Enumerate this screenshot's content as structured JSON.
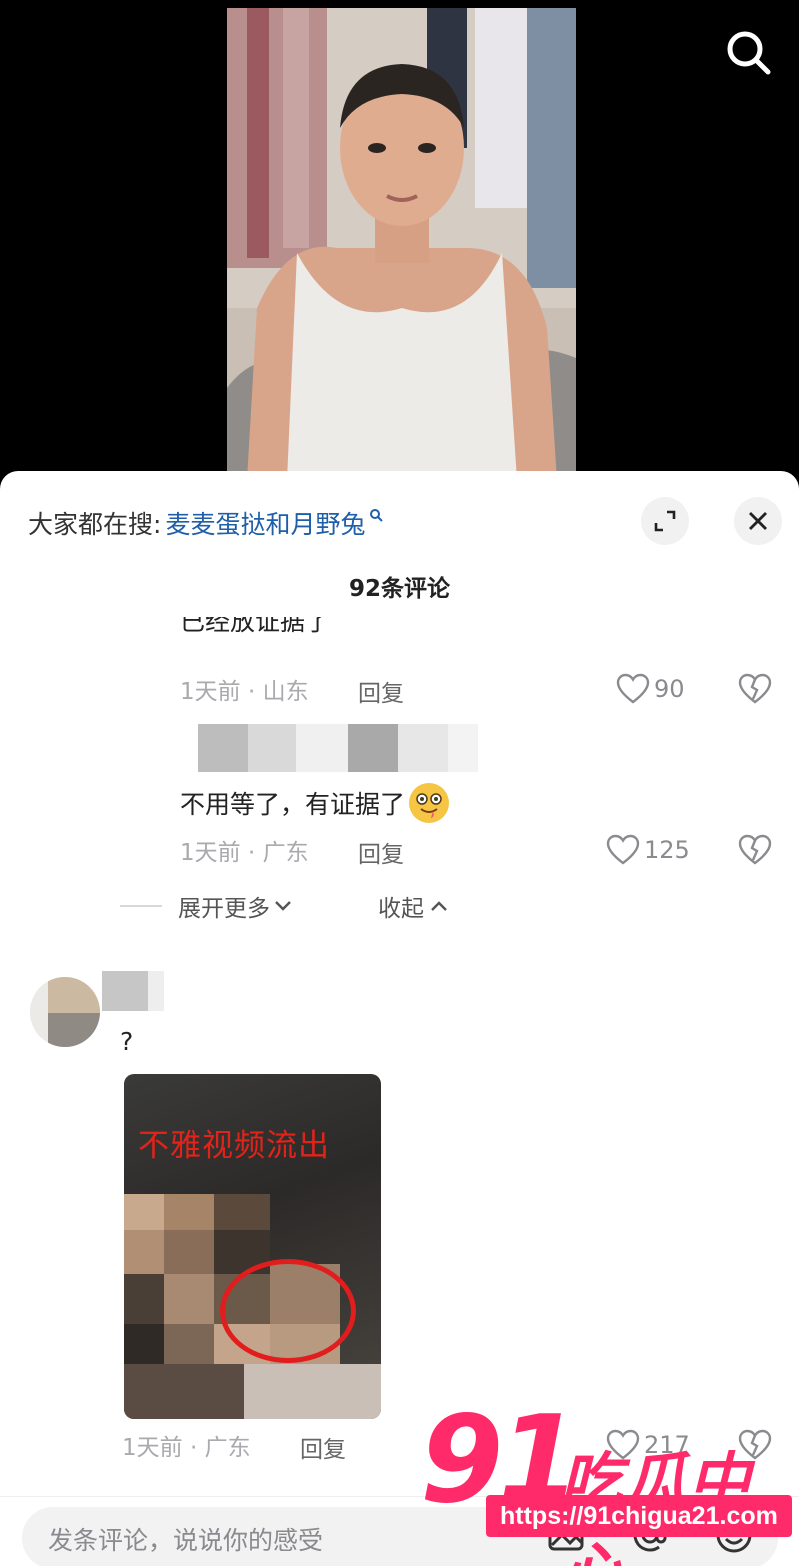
{
  "video": {
    "search_icon": "search-icon"
  },
  "sheet": {
    "trending_prefix": "大家都在搜:",
    "trending_query": "麦麦蛋挞和月野兔",
    "trending_icon": "search-small-icon",
    "expand_icon": "expand-icon",
    "close_icon": "close-icon",
    "comment_count": "92条评论"
  },
  "comments": {
    "c1": {
      "text_cut": "已经放证据了",
      "time_location": "1天前 · 山东",
      "reply": "回复",
      "likes": "90"
    },
    "c2": {
      "text": "不用等了，有证据了",
      "emoji": "drooling-face-emoji",
      "time_location": "1天前 · 广东",
      "reply": "回复",
      "likes": "125"
    },
    "thread_controls": {
      "expand_more": "展开更多",
      "collapse": "收起"
    },
    "c3": {
      "text": "?",
      "image_caption": "不雅视频流出",
      "time_location": "1天前 · 广东",
      "reply": "回复",
      "likes": "217"
    }
  },
  "watermark": {
    "number": "91",
    "name": "吃瓜中心",
    "url": "https://91chigua21.com"
  },
  "input": {
    "placeholder": "发条评论，说说你的感受"
  },
  "colors": {
    "link_blue": "#1f5fa8",
    "watermark_pink": "#ff2a6a",
    "ring_red": "#e11d1d"
  }
}
